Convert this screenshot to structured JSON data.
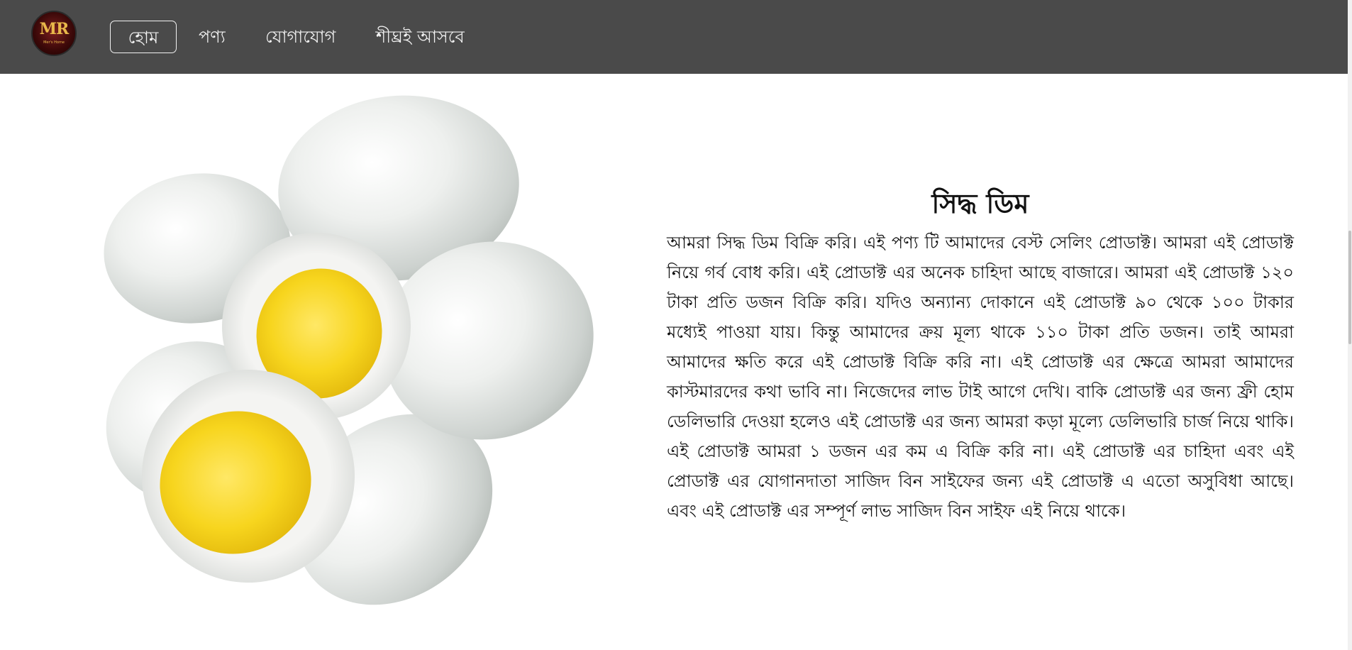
{
  "nav": {
    "logo_text": "MR",
    "logo_sub": "Mer's Home",
    "items": [
      {
        "label": "হোম"
      },
      {
        "label": "পণ্য"
      },
      {
        "label": "যোগাযোগ"
      },
      {
        "label": "শীঘ্রই আসবে"
      }
    ],
    "background_color": "#4a4a4a"
  },
  "product": {
    "title": "সিদ্ধ ডিম",
    "description": "আমরা সিদ্ধ ডিম বিক্রি করি। এই পণ্য টি আমাদের বেস্ট সেলিং প্রোডাক্ট। আমরা এই প্রোডাক্ট নিয়ে গর্ব বোধ করি। এই প্রোডাক্ট এর অনেক চাহিদা আছে বাজারে। আমরা এই প্রোডাক্ট ১২০ টাকা প্রতি ডজন বিক্রি করি। যদিও অন্যান্য দোকানে এই প্রোডাক্ট ৯০ থেকে ১০০ টাকার মধ্যেই পাওয়া যায়। কিন্তু আমাদের ক্রয় মূল্য থাকে ১১০ টাকা প্রতি ডজন। তাই আমরা আমাদের ক্ষতি করে এই প্রোডাক্ট বিক্রি করি না। এই প্রোডাক্ট এর ক্ষেত্রে আমরা আমাদের কাস্টমারদের কথা ভাবি না। নিজেদের লাভ টাই আগে দেখি। বাকি প্রোডাক্ট এর জন্য ফ্রী হোম ডেলিভারি দেওয়া হলেও এই প্রোডাক্ট এর জন্য আমরা কড়া মূল্যে ডেলিভারি চার্জ নিয়ে থাকি। এই প্রোডাক্ট আমরা ১ ডজন এর কম এ বিক্রি করি না। এই প্রোডাক্ট এর চাহিদা এবং এই প্রোডাক্ট এর যোগানদাতা সাজিদ বিন সাইফের জন্য এই প্রোডাক্ট এ এতো অসুবিধা আছে। এবং এই প্রোডাক্ট এর সম্পূর্ণ লাভ সাজিদ বিন সাইফ এই নিয়ে থাকে।"
  },
  "colors": {
    "egg_white": "#e9ecea",
    "yolk": "#f5d21c"
  }
}
